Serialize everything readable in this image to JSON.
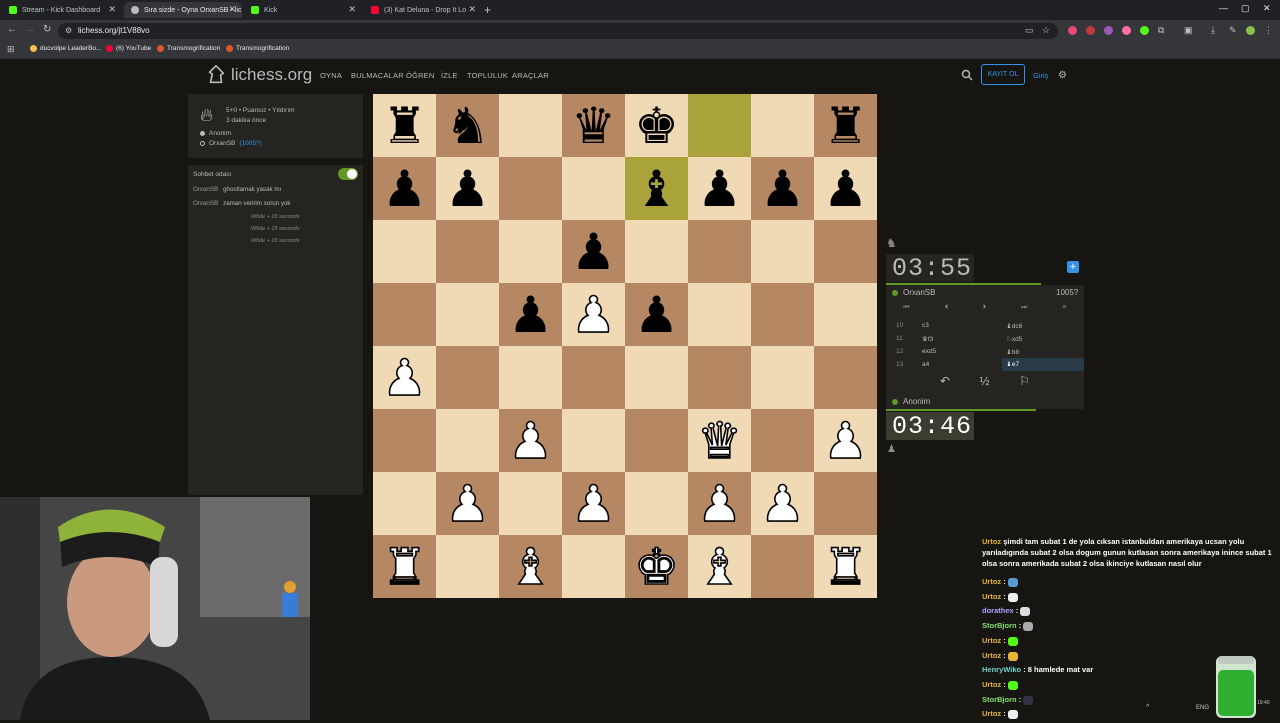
{
  "browser": {
    "tabs": [
      {
        "title": "Stream - Kick Dashboard",
        "active": false
      },
      {
        "title": "Sıra sizde - Oyna OrxanSB • lic",
        "active": true
      },
      {
        "title": "Kick",
        "active": false
      },
      {
        "title": "(3) Kat Deluna - Drop It Lo",
        "active": false
      }
    ],
    "url": "lichess.org/jt1V88vo",
    "bookmarks": [
      "ducvolpe LeaderBo...",
      "(6) YouTube",
      "Transmogrification",
      "Transmogrification"
    ]
  },
  "header": {
    "site_name": "lichess.org",
    "nav": [
      "OYNA",
      "BULMACALAR",
      "ÖĞREN",
      "İZLE",
      "TOPLULUK",
      "ARAÇLAR"
    ],
    "signup": "KAYIT OL",
    "login": "Giriş"
  },
  "game_info": {
    "type": "5+0 • Puansız • Yıldırım",
    "time_ago": "3 dakika önce",
    "player1": "Anonim",
    "player2_name": "OrxanSB",
    "player2_rating": "(1005?)"
  },
  "chat": {
    "title": "Sohbet odası",
    "messages": [
      {
        "user": "OrxanSB",
        "text": "ghostlamak yasak mı"
      },
      {
        "user": "OrxanSB",
        "text": "zaman veririm sorun yok"
      }
    ],
    "system": [
      "White + 15 seconds",
      "White + 15 seconds",
      "White + 15 seconds"
    ]
  },
  "board": {
    "rows": [
      [
        "r",
        "n",
        "",
        "q",
        "k",
        "",
        "",
        "r"
      ],
      [
        "p",
        "p",
        "",
        "",
        "b",
        "p",
        "p",
        "p"
      ],
      [
        "",
        "",
        "",
        "p",
        "",
        "",
        "",
        ""
      ],
      [
        "",
        "",
        "p",
        "P",
        "p",
        "",
        "",
        ""
      ],
      [
        "P",
        "",
        "",
        "",
        "",
        "",
        "",
        ""
      ],
      [
        "",
        "",
        "P",
        "",
        "",
        "Q",
        "",
        "P"
      ],
      [
        "",
        "P",
        "",
        "P",
        "",
        "P",
        "P",
        ""
      ],
      [
        "R",
        "",
        "B",
        "",
        "K",
        "B",
        "",
        "R"
      ]
    ],
    "highlight": [
      [
        0,
        5
      ],
      [
        1,
        4
      ]
    ]
  },
  "clocks": {
    "top": "03:55",
    "bottom": "03:46"
  },
  "players": {
    "top_name": "OrxanSB",
    "top_rating": "1005?",
    "bottom_name": "Anonim"
  },
  "moves": [
    {
      "num": "10",
      "white": "c3",
      "black": "♝dc6"
    },
    {
      "num": "11",
      "white": "♛f3",
      "black": "♘xd5"
    },
    {
      "num": "12",
      "white": "exd5",
      "black": "♝b8"
    },
    {
      "num": "13",
      "white": "a4",
      "black": "♝e7"
    }
  ],
  "stream_chat": [
    {
      "user": "Urtoz",
      "text": "şimdi tam subat 1 de yola cıksan istanbuldan amerikaya ucsan yolu yarıladıgında subat 2 olsa dogum gunun kutlasan sonra amerikaya inince subat 1 olsa sonra amerikada subat 2 olsa ikinciye kutlasan nasıl olur"
    },
    {
      "user": "Urtoz",
      "text": ":"
    },
    {
      "user": "Urtoz",
      "text": ":"
    },
    {
      "user": "dorathex",
      "text": ":"
    },
    {
      "user": "StorBjorn",
      "text": ":"
    },
    {
      "user": "Urtoz",
      "text": ":"
    },
    {
      "user": "Urtoz",
      "text": ":"
    },
    {
      "user": "HenryWiko",
      "text": ": 8 hamlede mat var"
    },
    {
      "user": "Urtoz",
      "text": ":"
    },
    {
      "user": "StorBjorn",
      "text": ":"
    },
    {
      "user": "Urtoz",
      "text": ":"
    }
  ],
  "taskbar": {
    "lang": "ENG",
    "time": "19:40"
  },
  "colors": {
    "accent": "#3692e7",
    "green": "#629924",
    "board_light": "#f0d9b5",
    "board_dark": "#b58863"
  }
}
